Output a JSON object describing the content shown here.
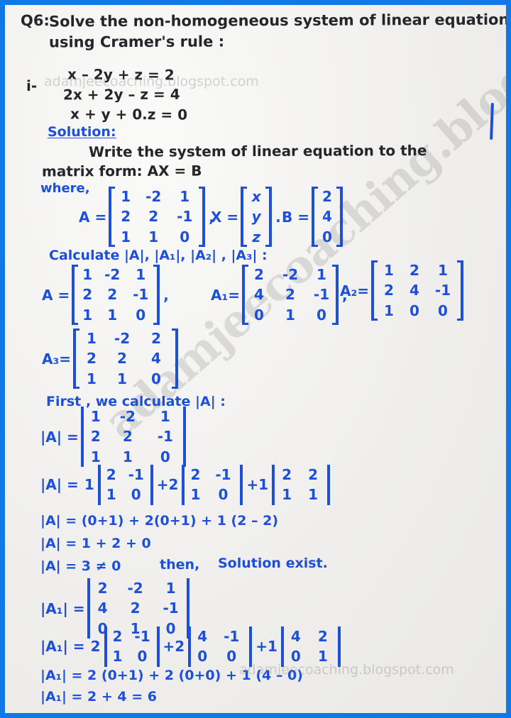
{
  "document": {
    "type": "handwritten-math-worksheet",
    "ink_black": "#23272b",
    "ink_blue": "#1d4fd8",
    "border_color": "#1278e8",
    "paper_color": "#f2f2f0"
  },
  "watermark": {
    "text": "adamjeecoaching.blogspot.com",
    "diagonal_text": "adamjeecoaching.blogspot.com"
  },
  "question": {
    "label": "Q6:",
    "line1": "Solve  the  non-homogeneous system  of  linear  equation",
    "line2": "using  Cramer's  rule :"
  },
  "part_marker": "i-",
  "system": {
    "eq1": "x – 2y + z = 2",
    "eq2": "2x + 2y – z =  4",
    "eq3": "x + y + 0.z = 0"
  },
  "solution": {
    "heading": "Solution:",
    "intro_line1": "Write  the  system of   linear   equation  to  the",
    "intro_line2": "matrix  form:    AX = B",
    "where_label": "where,"
  },
  "matrices": {
    "A_label": "A =",
    "A": [
      [
        "1",
        "-2",
        "1"
      ],
      [
        "2",
        "2",
        "-1"
      ],
      [
        "1",
        "1",
        "0"
      ]
    ],
    "X_label": "X =",
    "X": [
      [
        "x"
      ],
      [
        "y"
      ],
      [
        "z"
      ]
    ],
    "B_label": "B =",
    "B": [
      [
        "2"
      ],
      [
        "4"
      ],
      [
        "0"
      ]
    ],
    "comma1": ",",
    "comma2": ".",
    "calc_heading": "Calculate  |A|, |A₁|, |A₂| , |A₃| :",
    "A1_label": "A₁=",
    "A1": [
      [
        "2",
        "-2",
        "1"
      ],
      [
        "4",
        "2",
        "-1"
      ],
      [
        "0",
        "1",
        "0"
      ]
    ],
    "A2_label": "A₂=",
    "A2": [
      [
        "1",
        "2",
        "1"
      ],
      [
        "2",
        "4",
        "-1"
      ],
      [
        "1",
        "0",
        "0"
      ]
    ],
    "A3_label": "A₃=",
    "A3": [
      [
        "1",
        "-2",
        "2"
      ],
      [
        "2",
        "2",
        "4"
      ],
      [
        "1",
        "1",
        "0"
      ]
    ]
  },
  "detA": {
    "heading": "First , we  calculate   |A| :",
    "label": "|A| =",
    "matrix": [
      [
        "1",
        "-2",
        "1"
      ],
      [
        "2",
        "2",
        "-1"
      ],
      [
        "1",
        "1",
        "0"
      ]
    ],
    "expansion_label": "|A| =",
    "coef1": "1",
    "minor1": [
      [
        "2",
        "-1"
      ],
      [
        "1",
        "0"
      ]
    ],
    "op1": "+2",
    "minor2": [
      [
        "2",
        "-1"
      ],
      [
        "1",
        "0"
      ]
    ],
    "op2": "+1",
    "minor3": [
      [
        "2",
        "2"
      ],
      [
        "1",
        "1"
      ]
    ],
    "step1": "|A| = (0+1) + 2(0+1) + 1 (2 – 2)",
    "step2": "|A| = 1 + 2 + 0",
    "step3": "|A| = 3 ≠ 0",
    "conclusion_then": "then,",
    "conclusion": "Solution exist."
  },
  "detA1": {
    "label": "|A₁| =",
    "matrix": [
      [
        "2",
        "-2",
        "1"
      ],
      [
        "4",
        "2",
        "-1"
      ],
      [
        "0",
        "1",
        "0"
      ]
    ],
    "expansion_label": "|A₁| =",
    "coef1": "2",
    "minor1": [
      [
        "2",
        "-1"
      ],
      [
        "1",
        "0"
      ]
    ],
    "op1": "+2",
    "minor2": [
      [
        "4",
        "-1"
      ],
      [
        "0",
        "0"
      ]
    ],
    "op2": "+1",
    "minor3": [
      [
        "4",
        "2"
      ],
      [
        "0",
        "1"
      ]
    ],
    "step1": "|A₁| = 2 (0+1) + 2 (0+0) + 1 (4 – 0)",
    "step2": "|A₁| = 2 + 4  = 6"
  }
}
